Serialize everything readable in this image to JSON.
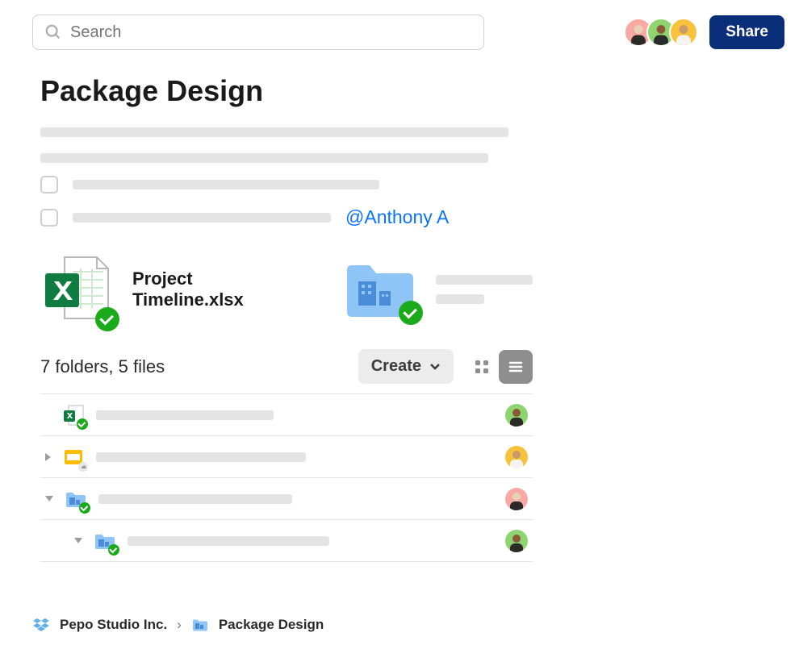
{
  "topbar": {
    "search_placeholder": "Search",
    "share_label": "Share",
    "avatars": [
      {
        "bg": "#f8a9a3"
      },
      {
        "bg": "#8ed56f"
      },
      {
        "bg": "#f9c23c"
      }
    ]
  },
  "page": {
    "title": "Package Design",
    "mention": "@Anthony A"
  },
  "cards": {
    "file_name": "Project Timeline.xlsx"
  },
  "summary": {
    "count_text": "7 folders, 5 files",
    "create_label": "Create"
  },
  "list": {
    "rows": [
      {
        "type": "excel",
        "avatar_bg": "#8ed56f",
        "expand": "none",
        "synced": true
      },
      {
        "type": "slides",
        "avatar_bg": "#f9c23c",
        "expand": "right",
        "synced": false
      },
      {
        "type": "folder",
        "avatar_bg": "#f8a9a3",
        "expand": "down",
        "synced": true
      },
      {
        "type": "folder",
        "avatar_bg": "#8ed56f",
        "expand": "down",
        "synced": true,
        "nested": true
      }
    ]
  },
  "breadcrumb": {
    "root": "Pepo Studio Inc.",
    "current": "Package Design"
  },
  "colors": {
    "folder_blue": "#8fc4f7",
    "excel_green": "#107c41",
    "slides_yellow": "#fbbc04",
    "dropbox_blue": "#5fb0e8",
    "share_bg": "#0b2e7a",
    "link_blue": "#0a73ff"
  }
}
